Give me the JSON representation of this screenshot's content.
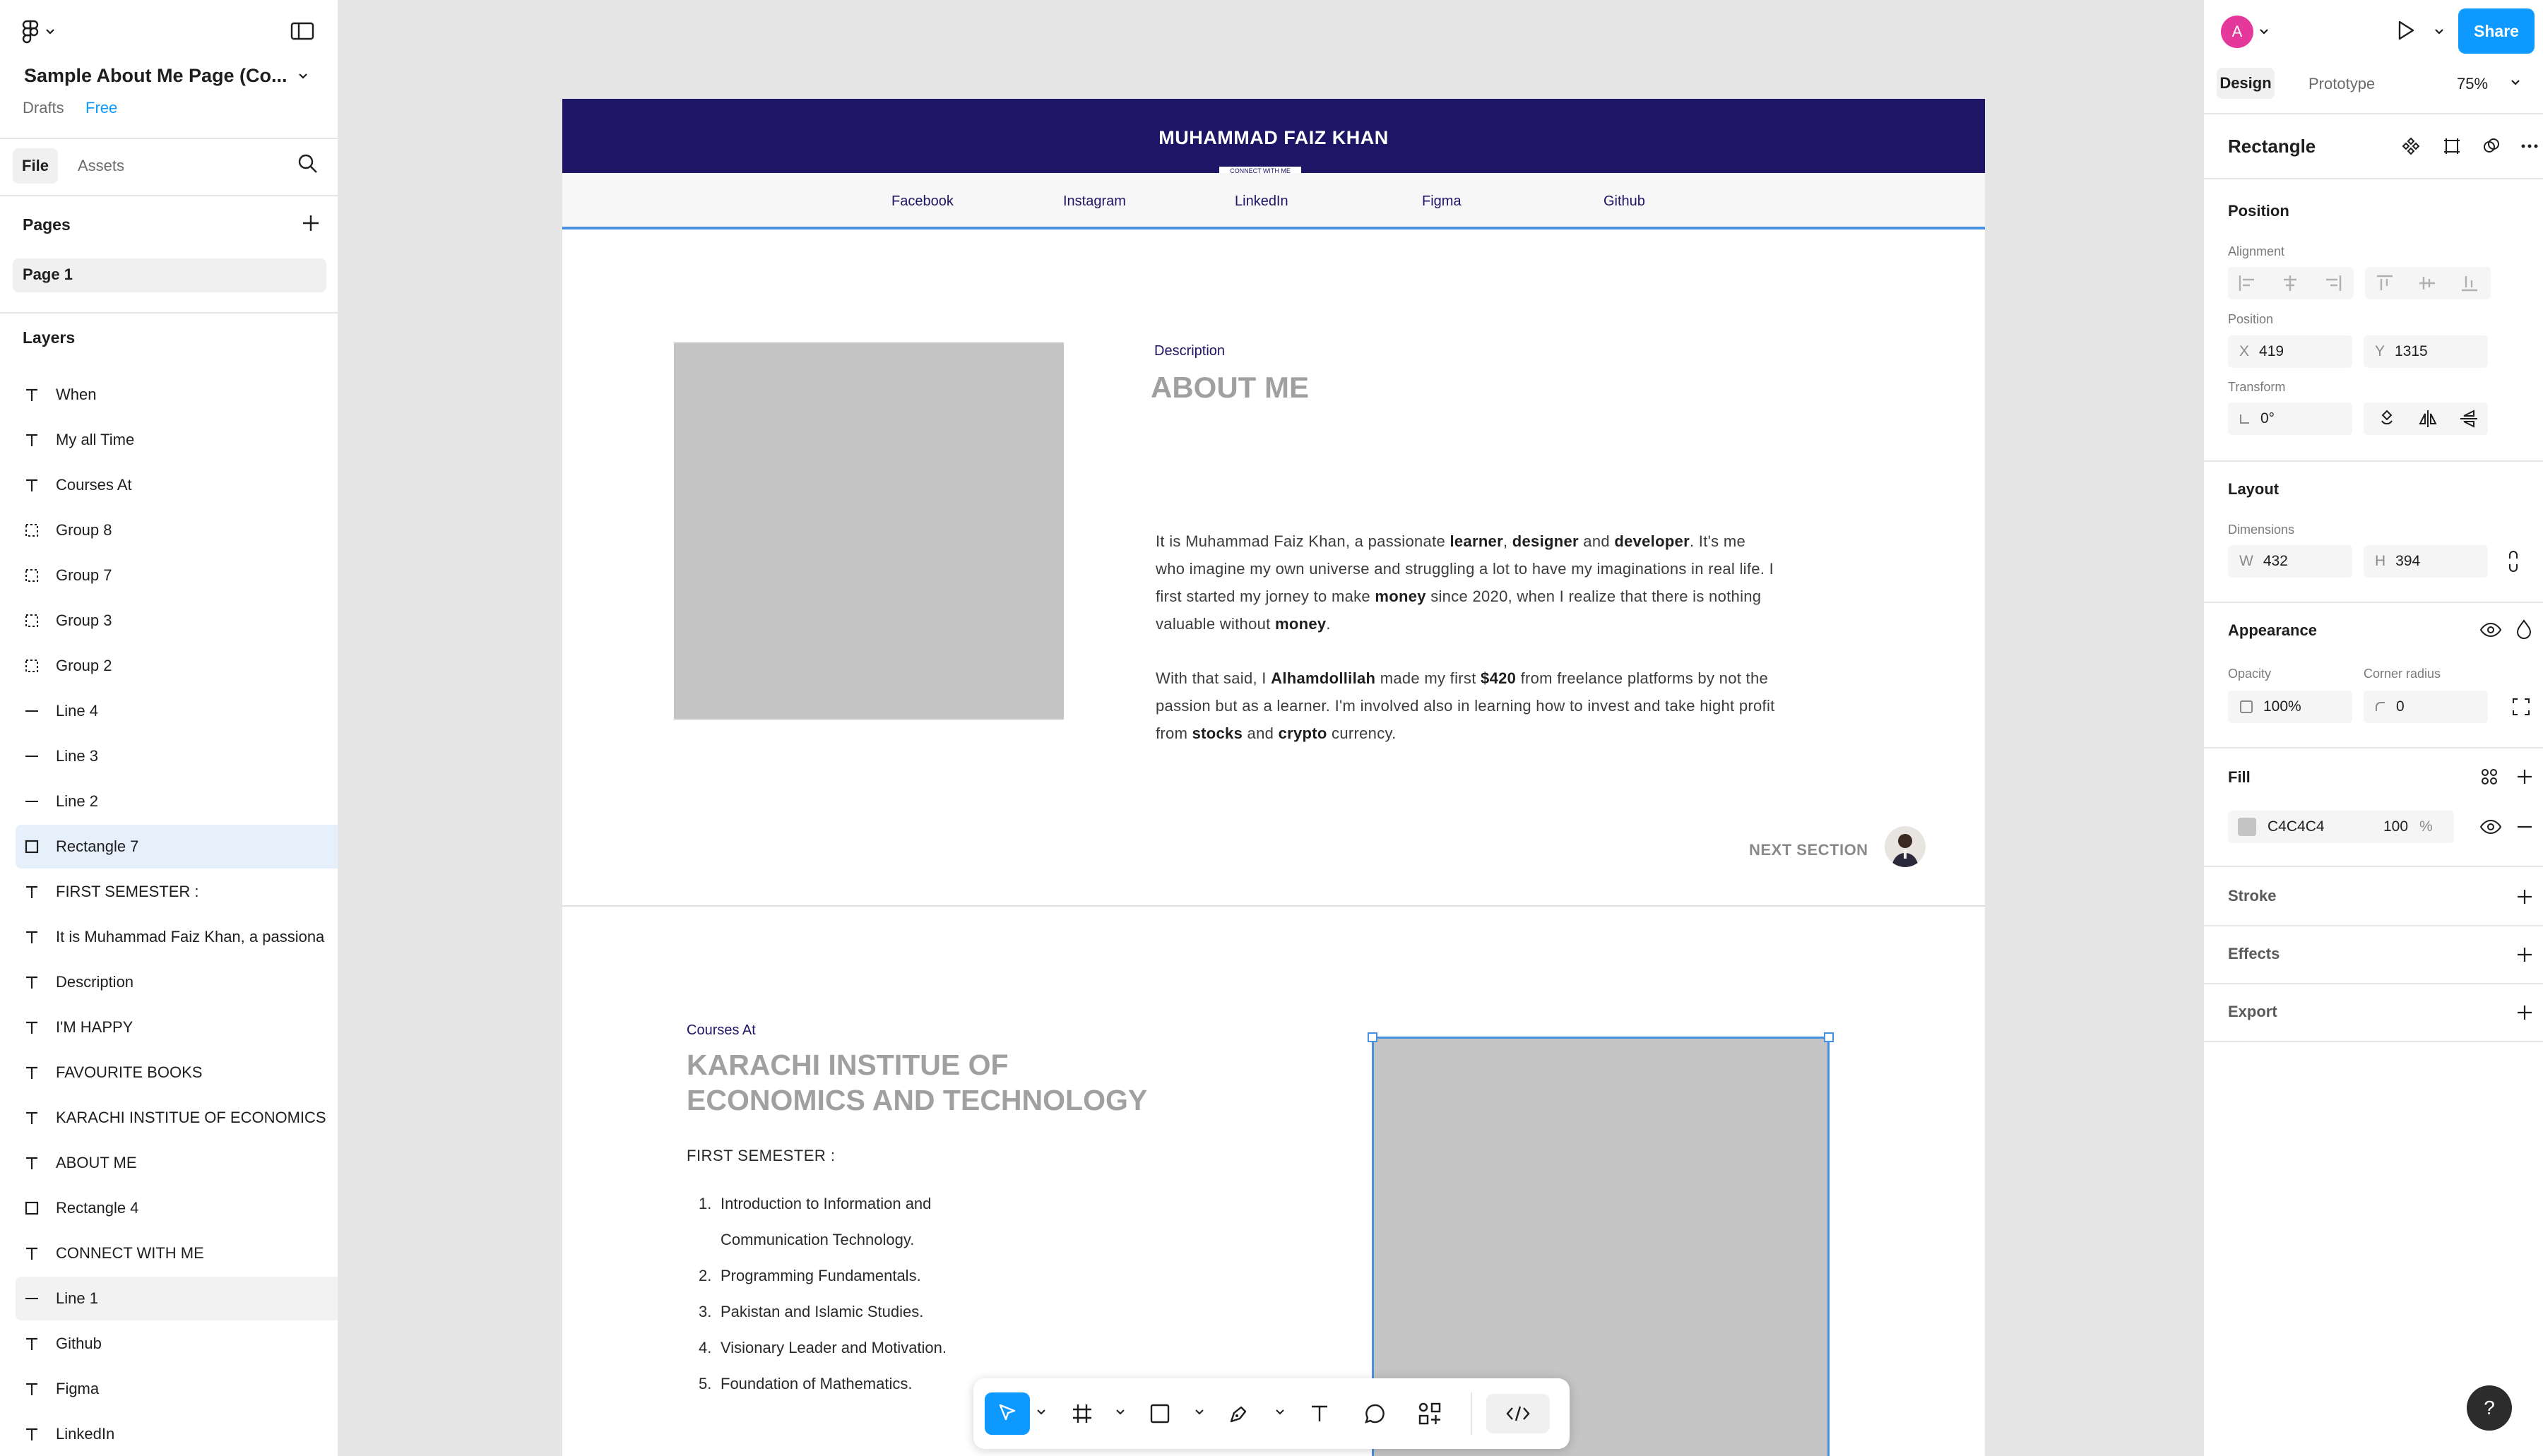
{
  "file": {
    "title": "Sample About Me Page (Co...",
    "location": "Drafts",
    "plan_badge": "Free"
  },
  "left_tabs": {
    "file": "File",
    "assets": "Assets"
  },
  "pages": {
    "header": "Pages",
    "items": [
      "Page 1"
    ]
  },
  "layers": {
    "header": "Layers",
    "items": [
      {
        "type": "text",
        "label": "When"
      },
      {
        "type": "text",
        "label": "My all Time"
      },
      {
        "type": "text",
        "label": "Courses At"
      },
      {
        "type": "group",
        "label": "Group 8"
      },
      {
        "type": "group",
        "label": "Group 7"
      },
      {
        "type": "group",
        "label": "Group 3"
      },
      {
        "type": "group",
        "label": "Group 2"
      },
      {
        "type": "line",
        "label": "Line 4"
      },
      {
        "type": "line",
        "label": "Line 3"
      },
      {
        "type": "line",
        "label": "Line 2"
      },
      {
        "type": "rect",
        "label": "Rectangle 7",
        "selected": true
      },
      {
        "type": "text",
        "label": "FIRST SEMESTER :"
      },
      {
        "type": "text",
        "label": "It is Muhammad Faiz Khan, a passiona"
      },
      {
        "type": "text",
        "label": "Description"
      },
      {
        "type": "text",
        "label": "I'M HAPPY"
      },
      {
        "type": "text",
        "label": "FAVOURITE BOOKS"
      },
      {
        "type": "text",
        "label": "KARACHI INSTITUE OF ECONOMICS"
      },
      {
        "type": "text",
        "label": "ABOUT ME"
      },
      {
        "type": "rect",
        "label": "Rectangle 4"
      },
      {
        "type": "text",
        "label": "CONNECT WITH ME"
      },
      {
        "type": "line",
        "label": "Line 1",
        "hover": true
      },
      {
        "type": "text",
        "label": "Github"
      },
      {
        "type": "text",
        "label": "Figma"
      },
      {
        "type": "text",
        "label": "LinkedIn"
      }
    ]
  },
  "topbar": {
    "avatar_initial": "A",
    "share_label": "Share"
  },
  "right_tabs": {
    "design": "Design",
    "prototype": "Prototype",
    "zoom": "75%"
  },
  "inspector": {
    "layer_name": "Rectangle",
    "position": {
      "title": "Position",
      "alignment_label": "Alignment",
      "position_label": "Position",
      "x_label": "X",
      "x": "419",
      "y_label": "Y",
      "y": "1315",
      "transform_label": "Transform",
      "rotation": "0°"
    },
    "layout": {
      "title": "Layout",
      "dimensions_label": "Dimensions",
      "w_label": "W",
      "w": "432",
      "h_label": "H",
      "h": "394"
    },
    "appearance": {
      "title": "Appearance",
      "opacity_label": "Opacity",
      "opacity": "100%",
      "radius_label": "Corner radius",
      "radius": "0"
    },
    "fill": {
      "title": "Fill",
      "hex": "C4C4C4",
      "opacity": "100",
      "unit": "%",
      "swatch": "#c4c4c4"
    },
    "stroke": {
      "title": "Stroke"
    },
    "effects": {
      "title": "Effects"
    },
    "export": {
      "title": "Export"
    }
  },
  "canvas": {
    "header_title": "MUHAMMAD FAIZ KHAN",
    "header_tag": "CONNECT WITH ME",
    "nav_links": [
      "Facebook",
      "Instagram",
      "LinkedIn",
      "Figma",
      "Github"
    ],
    "about": {
      "eyebrow": "Description",
      "heading": "ABOUT ME",
      "p1": [
        {
          "t": "It is Muhammad Faiz Khan, a passionate "
        },
        {
          "t": "learner",
          "b": true
        },
        {
          "t": ", "
        },
        {
          "t": "designer",
          "b": true
        },
        {
          "t": " and "
        },
        {
          "t": "developer",
          "b": true
        },
        {
          "t": ". It's me who imagine my own universe and struggling a lot to have my imaginations in real life. I first started my jorney to make "
        },
        {
          "t": "money",
          "b": true
        },
        {
          "t": " since 2020, when I realize that there is nothing valuable without "
        },
        {
          "t": "money",
          "b": true
        },
        {
          "t": "."
        }
      ],
      "p2": [
        {
          "t": "With that said, I "
        },
        {
          "t": "Alhamdollilah",
          "b": true
        },
        {
          "t": " made my first "
        },
        {
          "t": "$420",
          "b": true
        },
        {
          "t": " from freelance platforms by not the passion but as a learner. I'm involved also in learning how to invest and take hight profit from "
        },
        {
          "t": "stocks",
          "b": true
        },
        {
          "t": " and "
        },
        {
          "t": "crypto",
          "b": true
        },
        {
          "t": " currency."
        }
      ],
      "next_section": "NEXT SECTION"
    },
    "courses": {
      "eyebrow": "Courses At",
      "heading_line1": "KARACHI INSTITUE OF",
      "heading_line2": "ECONOMICS AND TECHNOLOGY",
      "semester": "FIRST SEMESTER :",
      "items": [
        {
          "n": "1.",
          "text": "Introduction to Information and"
        },
        {
          "n": "",
          "text": "Communication Technology."
        },
        {
          "n": "2.",
          "text": "Programming Fundamentals."
        },
        {
          "n": "3.",
          "text": "Pakistan and Islamic Studies."
        },
        {
          "n": "4.",
          "text": "Visionary Leader and Motivation."
        },
        {
          "n": "5.",
          "text": "Foundation of Mathematics."
        }
      ]
    }
  },
  "colors": {
    "header_bg": "#1e1566",
    "selection": "#0d99ff",
    "placeholder": "#c4c4c4",
    "heading_grey": "#a0a0a0",
    "share_button": "#0d99ff",
    "avatar": "#e5389b"
  }
}
